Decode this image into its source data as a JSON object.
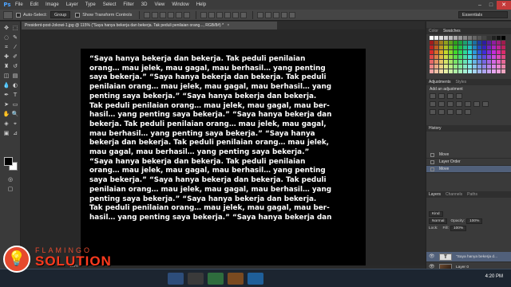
{
  "menubar": {
    "logo": "Ps",
    "items": [
      "File",
      "Edit",
      "Image",
      "Layer",
      "Type",
      "Select",
      "Filter",
      "3D",
      "View",
      "Window",
      "Help"
    ],
    "minimize": "–",
    "maximize": "□",
    "close": "✕"
  },
  "options": {
    "auto_select_label": "Auto-Select:",
    "auto_select_value": "Group",
    "transform_label": "Show Transform Controls",
    "workspace": "Essentials"
  },
  "document": {
    "tab_title": "President-post-Jokowi-1.jpg @ 115% (\"Saya hanya bekerja dan bekerja. Tak peduli penilaian orang..., RGB/8#) *",
    "close": "×",
    "zoom": "115%",
    "canvas_text": "“Saya hanya bekerja dan bekerja. Tak peduli penilaian\norang… mau jelek, mau gagal, mau berhasil… yang penting\nsaya bekerja.”  “Saya hanya bekerja dan bekerja. Tak peduli\npenilaian orang… mau jelek, mau gagal, mau berhasil… yang\npenting saya bekerja.”  “Saya hanya bekerja dan bekerja.\nTak peduli penilaian orang… mau jelek, mau gagal, mau ber-\nhasil… yang penting saya bekerja.”  “Saya hanya bekerja dan\nbekerja. Tak peduli penilaian orang… mau jelek, mau gagal,\nmau berhasil… yang penting saya bekerja.”  “Saya hanya\nbekerja dan bekerja. Tak peduli penilaian orang… mau jelek,\nmau gagal, mau berhasil… yang penting saya bekerja.”\n“Saya hanya bekerja dan bekerja. Tak peduli penilaian\norang… mau jelek, mau gagal, mau berhasil… yang penting\nsaya bekerja.”  “Saya hanya bekerja dan bekerja. Tak peduli\npenilaian orang… mau jelek, mau gagal, mau berhasil… yang\npenting saya bekerja.”  “Saya hanya bekerja dan bekerja.\nTak peduli penilaian orang… mau jelek, mau gagal, mau ber-\nhasil… yang penting saya bekerja.”  “Saya hanya bekerja dan"
  },
  "panels": {
    "color_tab": "Color",
    "swatches_tab": "Swatches",
    "adjustments_tab": "Adjustments",
    "styles_tab": "Styles",
    "adjust_title": "Add an adjustment",
    "history_tab": "History",
    "history_items": [
      {
        "label": "Move",
        "selected": false
      },
      {
        "label": "Layer Order",
        "selected": false
      },
      {
        "label": "Move",
        "selected": true
      }
    ],
    "layers_tab": "Layers",
    "channels_tab": "Channels",
    "paths_tab": "Paths",
    "kind_label": "Kind",
    "blend_mode": "Normal",
    "opacity_label": "Opacity:",
    "opacity_value": "100%",
    "lock_label": "Lock:",
    "fill_label": "Fill:",
    "fill_value": "100%",
    "layers": [
      {
        "name": "\"Saya hanya bekerja d...",
        "thumb": "T",
        "kind": "text",
        "selected": true
      },
      {
        "name": "Layer 0",
        "thumb": "",
        "kind": "photo",
        "selected": false
      },
      {
        "name": "Layer 1",
        "thumb": "",
        "kind": "blank",
        "selected": false
      }
    ]
  },
  "taskbar": {
    "time": "4:20 PM"
  },
  "watermark": {
    "top": "FLAMINGO",
    "bottom": "SOLUTION",
    "badge": "💡"
  },
  "colors": {
    "accent_selected": "#51607a",
    "watermark_red": "#ff3a1e",
    "canvas_bg": "#000000",
    "canvas_text": "#ffffff"
  }
}
